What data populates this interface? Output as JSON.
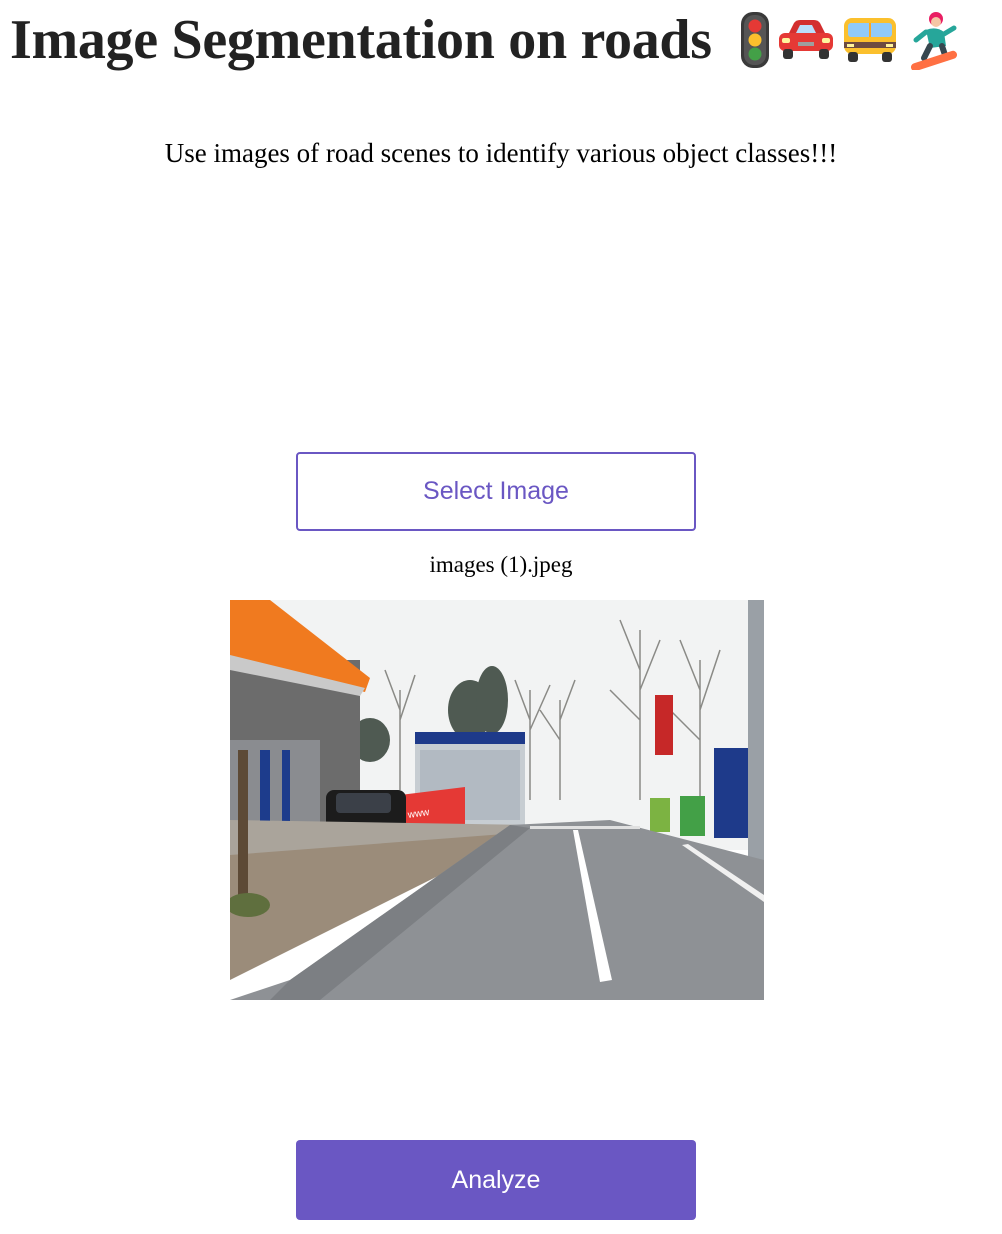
{
  "header": {
    "title": "Image Segmentation on roads",
    "title_icons": [
      "traffic-light-icon",
      "car-icon",
      "minibus-icon",
      "snowboarder-icon"
    ]
  },
  "main": {
    "subtitle": "Use images of road scenes to identify various object classes!!!",
    "select_label": "Select Image",
    "file_name": "images (1).jpeg",
    "preview_image": "road-scene-photo",
    "analyze_label": "Analyze"
  },
  "colors": {
    "accent": "#6a57c3",
    "button_text": "#ffffff",
    "page_background": "#ffffff"
  }
}
